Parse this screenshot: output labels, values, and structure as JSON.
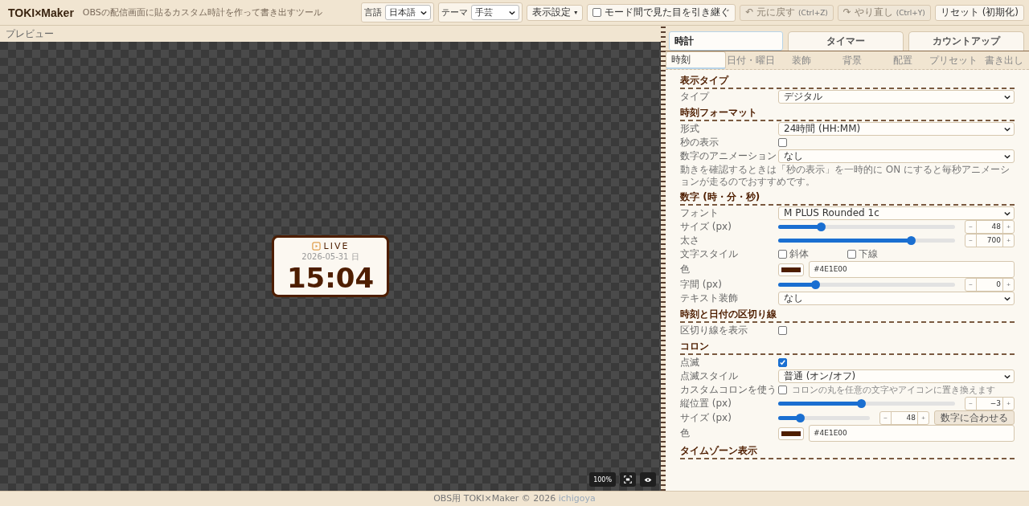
{
  "header": {
    "logo": "TOKI×Maker",
    "tagline": "OBSの配信画面に貼るカスタム時計を作って書き出すツール",
    "language": {
      "label": "言語",
      "value": "日本語"
    },
    "theme": {
      "label": "テーマ",
      "value": "手芸"
    },
    "display_button": {
      "label": "表示設定",
      "caret": "▾"
    },
    "carry_over": {
      "label": "モード間で見た目を引き継ぐ",
      "checked": false
    },
    "undo": {
      "icon": "↶",
      "label": "元に戻す",
      "shortcut": "(Ctrl+Z)",
      "disabled": true
    },
    "redo": {
      "icon": "↷",
      "label": "やり直し",
      "shortcut": "(Ctrl+Y)",
      "disabled": true
    },
    "reset": {
      "label": "リセット (初期化)"
    }
  },
  "preview": {
    "label": "プレビュー",
    "clock": {
      "badge": "LIVE",
      "date": "2026-05-31 日",
      "time": "15:04"
    },
    "zoom": "100%"
  },
  "mode_tabs": [
    {
      "label": "時計",
      "selected": true
    },
    {
      "label": "タイマー",
      "selected": false
    },
    {
      "label": "カウントアップ",
      "selected": false
    }
  ],
  "sub_tabs": [
    {
      "label": "時刻",
      "selected": true
    },
    {
      "label": "日付・曜日",
      "selected": false
    },
    {
      "label": "装飾",
      "selected": false
    },
    {
      "label": "背景",
      "selected": false
    },
    {
      "label": "配置",
      "selected": false
    },
    {
      "label": "プリセット",
      "selected": false
    },
    {
      "label": "書き出し",
      "selected": false
    }
  ],
  "sections": [
    {
      "title": "表示タイプ",
      "rows": [
        {
          "kind": "select",
          "label": "タイプ",
          "value": "デジタル"
        }
      ]
    },
    {
      "title": "時刻フォーマット",
      "rows": [
        {
          "kind": "select",
          "label": "形式",
          "value": "24時間 (HH:MM)"
        },
        {
          "kind": "checkbox",
          "label": "秒の表示",
          "checked": false
        },
        {
          "kind": "select",
          "label": "数字のアニメーション",
          "value": "なし"
        },
        {
          "kind": "note",
          "text": "動きを確認するときは「秒の表示」を一時的に ON にすると毎秒アニメーションが走るのでおすすめです。"
        }
      ]
    },
    {
      "title": "数字 (時・分・秒)",
      "rows": [
        {
          "kind": "select",
          "label": "フォント",
          "value": "M PLUS Rounded 1c"
        },
        {
          "kind": "slider",
          "label": "サイズ (px)",
          "level": 0.24,
          "value": "48",
          "minus": "−",
          "plus": "+"
        },
        {
          "kind": "slider",
          "label": "太さ",
          "level": 0.75,
          "value": "700",
          "minus": "−",
          "plus": "+"
        },
        {
          "kind": "checks",
          "label": "文字スタイル",
          "options": [
            {
              "label": "斜体",
              "checked": false
            },
            {
              "label": "下線",
              "checked": false
            }
          ]
        },
        {
          "kind": "color",
          "label": "色",
          "color": "#4e1e00",
          "value": "#4E1E00"
        },
        {
          "kind": "slider",
          "label": "字間 (px)",
          "level": 0.21,
          "value": "0",
          "minus": "−",
          "plus": "+"
        },
        {
          "kind": "select",
          "label": "テキスト装飾",
          "value": "なし"
        }
      ]
    },
    {
      "title": "時刻と日付の区切り線",
      "rows": [
        {
          "kind": "checkbox",
          "label": "区切り線を表示",
          "checked": false
        }
      ]
    },
    {
      "title": "コロン",
      "rows": [
        {
          "kind": "checkbox",
          "label": "点滅",
          "checked": true
        },
        {
          "kind": "select",
          "label": "点滅スタイル",
          "value": "普通 (オン/オフ)"
        },
        {
          "kind": "checkbox",
          "label": "カスタムコロンを使う",
          "checked": false,
          "hint": "コロンの丸を任意の文字やアイコンに置き換えます"
        },
        {
          "kind": "slider",
          "label": "縦位置 (px)",
          "level": 0.47,
          "value": "−3",
          "minus": "−",
          "plus": "+"
        },
        {
          "kind": "slider",
          "label": "サイズ (px)",
          "level": 0.24,
          "value": "48",
          "minus": "−",
          "plus": "+",
          "button": "数字に合わせる"
        },
        {
          "kind": "color",
          "label": "色",
          "color": "#4e1e00",
          "value": "#4E1E00"
        }
      ]
    },
    {
      "title": "タイムゾーン表示"
    }
  ],
  "footer": {
    "text": "OBS用 TOKI×Maker © 2026",
    "link": "ichigoya"
  }
}
